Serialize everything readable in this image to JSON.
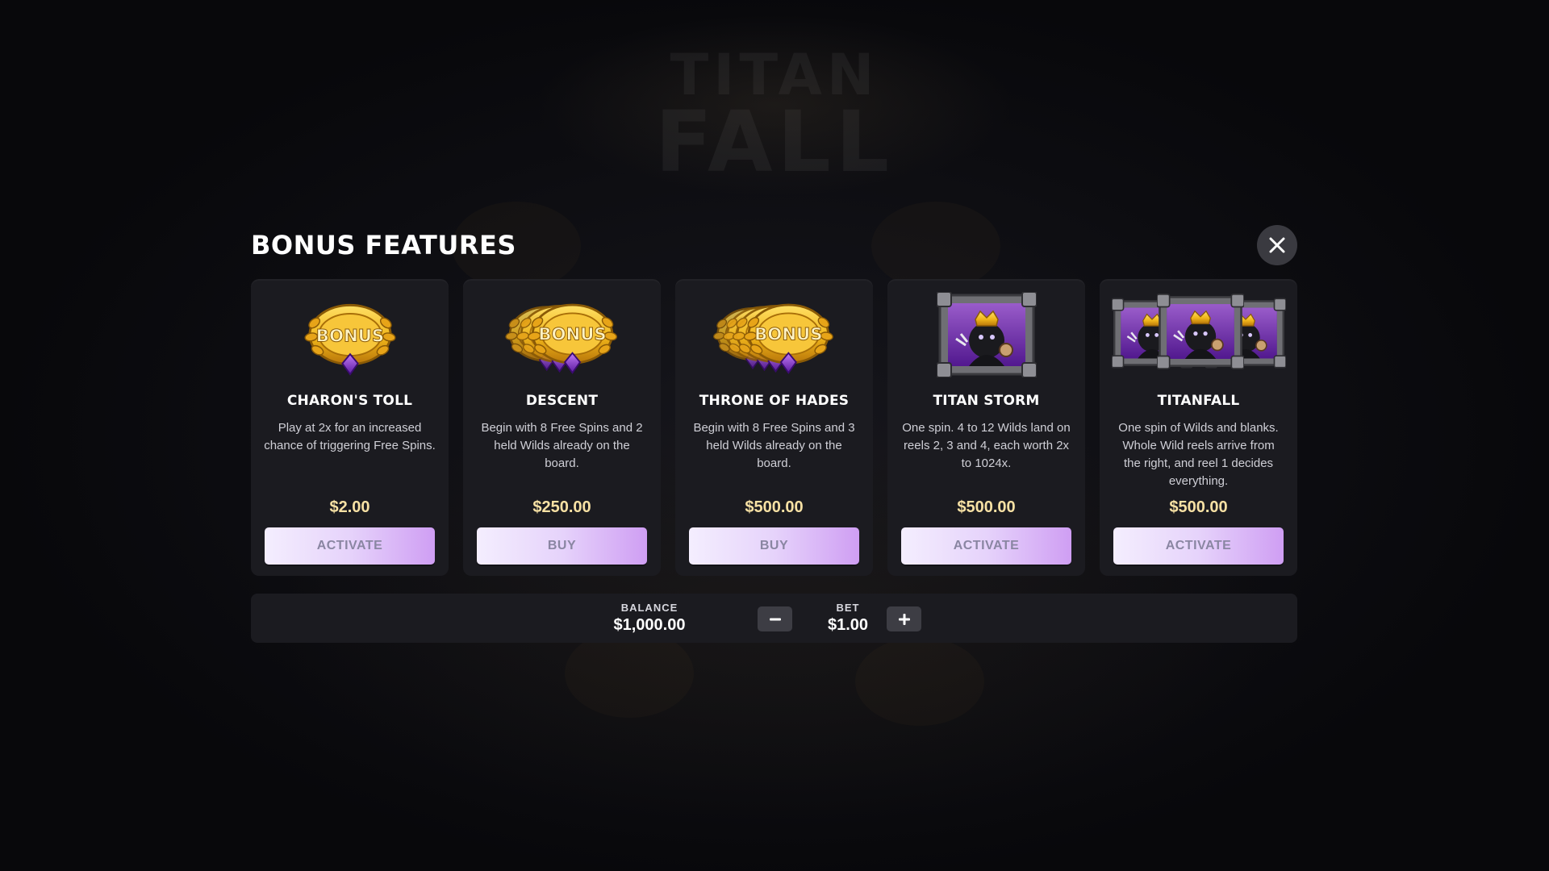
{
  "game_title_background": {
    "line1": "TITAN",
    "line2": "FALL"
  },
  "modal": {
    "title": "BONUS FEATURES",
    "close_icon": "close-icon"
  },
  "features": [
    {
      "name": "CHARON'S TOLL",
      "description": "Play at 2x for an increased chance of triggering Free Spins.",
      "price": "$2.00",
      "button": "ACTIVATE",
      "art": "bonus-coin-icon",
      "art_text": "BONUS"
    },
    {
      "name": "DESCENT",
      "description": "Begin with 8 Free Spins and 2 held Wilds already on the board.",
      "price": "$250.00",
      "button": "BUY",
      "art": "bonus-coin-stack-icon",
      "art_text": "BONUS"
    },
    {
      "name": "THRONE OF HADES",
      "description": "Begin with 8 Free Spins and 3 held Wilds already on the board.",
      "price": "$500.00",
      "button": "BUY",
      "art": "bonus-coin-stack-large-icon",
      "art_text": "BONUS"
    },
    {
      "name": "TITAN STORM",
      "description": "One spin. 4 to 12 Wilds land on reels 2, 3 and 4, each worth 2x to 1024x.",
      "price": "$500.00",
      "button": "ACTIVATE",
      "art": "hades-wild-card-icon"
    },
    {
      "name": "TITANFALL",
      "description": "One spin of Wilds and blanks. Whole Wild reels arrive from the right, and reel 1 decides everything.",
      "price": "$500.00",
      "button": "ACTIVATE",
      "art": "hades-wild-cards-triple-icon"
    }
  ],
  "footer": {
    "balance_label": "BALANCE",
    "balance_value": "$1,000.00",
    "bet_label": "BET",
    "bet_value": "$1.00",
    "decrease_icon": "minus-icon",
    "increase_icon": "plus-icon"
  },
  "colors": {
    "background": "#0b0b10",
    "card": "#1b1b20",
    "price": "#f7e1a4",
    "button_gradient_start": "#f4eefe",
    "button_gradient_end": "#cf9ef3",
    "button_text": "#8a86a2",
    "gold": "#e9b81e",
    "purple": "#8a2bd6"
  }
}
